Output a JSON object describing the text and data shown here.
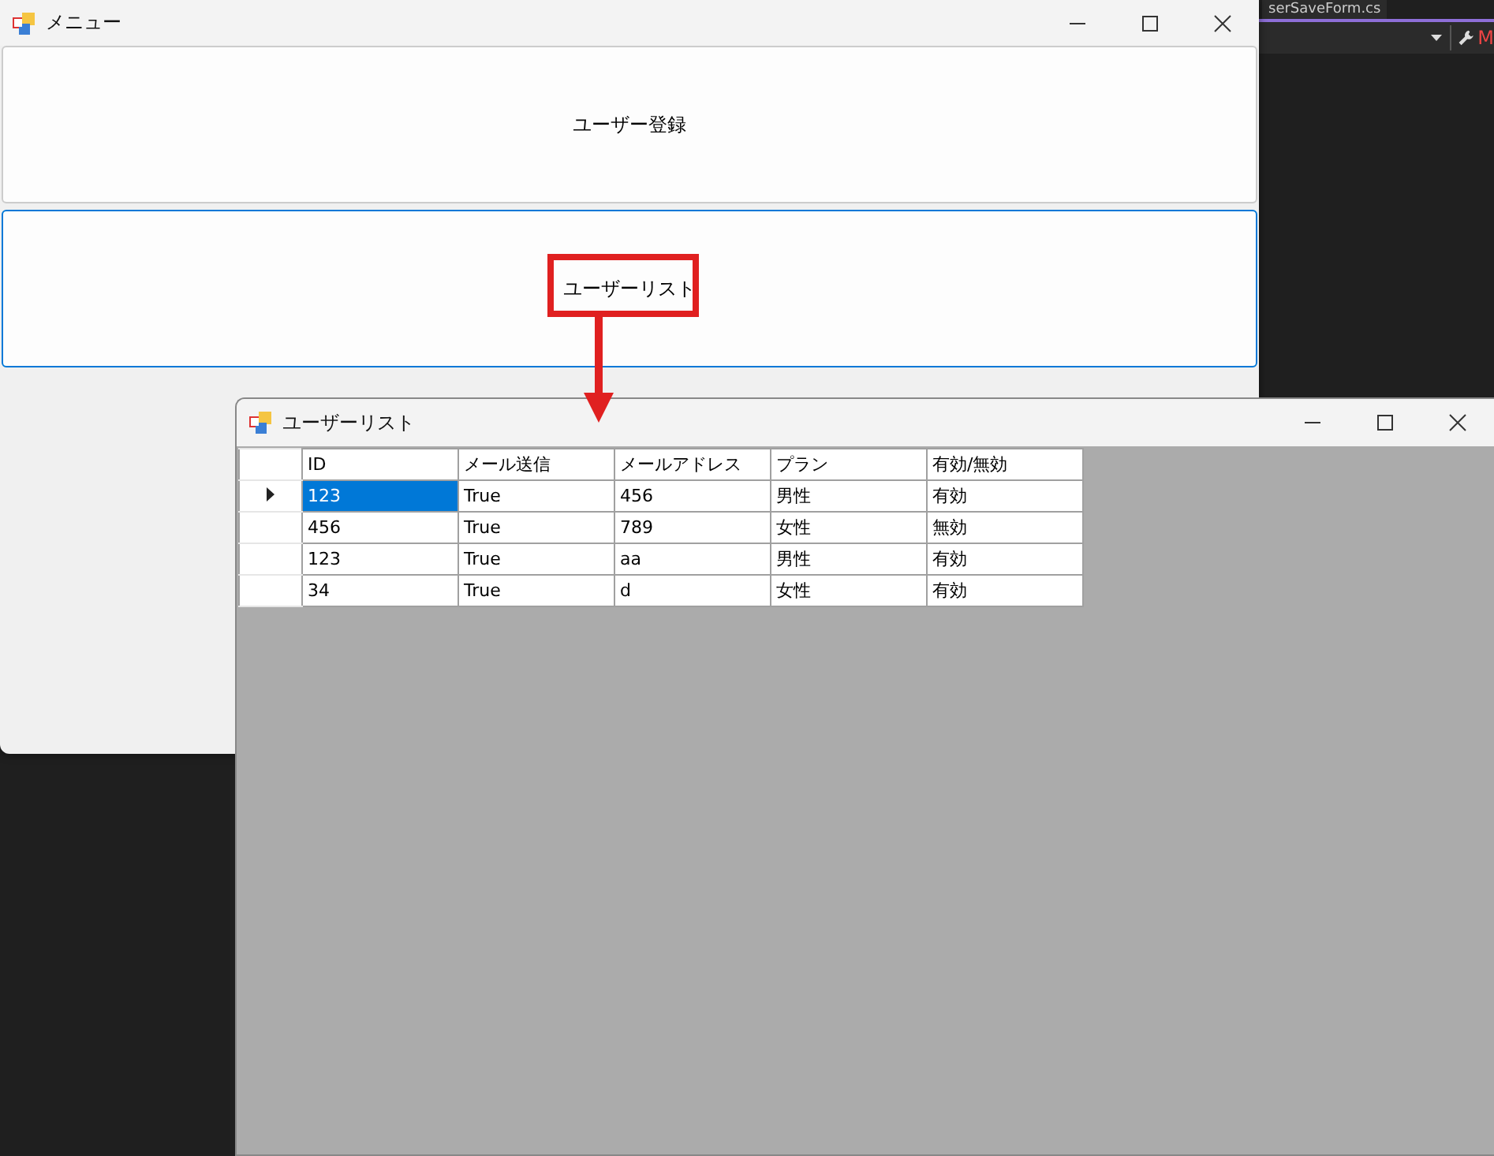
{
  "background_editor": {
    "tab_title": "serSaveForm.cs",
    "toolbar_letter": "M"
  },
  "menu_window": {
    "title": "メニュー",
    "buttons": [
      {
        "label": "ユーザー登録",
        "focused": false
      },
      {
        "label": "ユーザーリスト",
        "focused": true
      }
    ]
  },
  "user_list_window": {
    "title": "ユーザーリスト",
    "table": {
      "columns": [
        "ID",
        "メール送信",
        "メールアドレス",
        "プラン",
        "有効/無効"
      ],
      "rows": [
        {
          "current": true,
          "cells": [
            {
              "text": "123",
              "selected": true
            },
            {
              "text": "True",
              "selected": false
            },
            {
              "text": "456",
              "selected": false
            },
            {
              "text": "男性",
              "selected": false
            },
            {
              "text": "有効",
              "selected": false
            }
          ]
        },
        {
          "current": false,
          "cells": [
            {
              "text": "456",
              "selected": false
            },
            {
              "text": "True",
              "selected": false
            },
            {
              "text": "789",
              "selected": false
            },
            {
              "text": "女性",
              "selected": false
            },
            {
              "text": "無効",
              "selected": false
            }
          ]
        },
        {
          "current": false,
          "cells": [
            {
              "text": "123",
              "selected": false
            },
            {
              "text": "True",
              "selected": false
            },
            {
              "text": "aa",
              "selected": false
            },
            {
              "text": "男性",
              "selected": false
            },
            {
              "text": "有効",
              "selected": false
            }
          ]
        },
        {
          "current": false,
          "cells": [
            {
              "text": "34",
              "selected": false
            },
            {
              "text": "True",
              "selected": false
            },
            {
              "text": "d",
              "selected": false
            },
            {
              "text": "女性",
              "selected": false
            },
            {
              "text": "有効",
              "selected": false
            }
          ]
        }
      ]
    }
  }
}
